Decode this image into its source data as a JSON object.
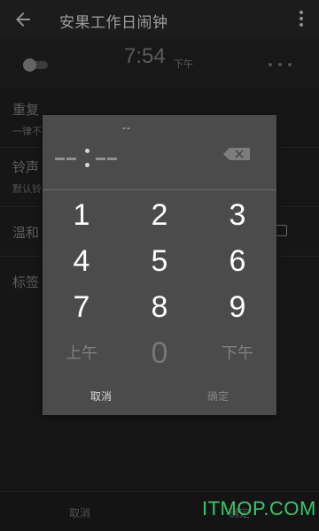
{
  "app_bar": {
    "title": "安果工作日闹钟",
    "back_icon": "arrow-left-icon",
    "menu_icon": "more-vertical-icon"
  },
  "alarm": {
    "time": "7:54",
    "ampm": "下午",
    "enabled": false,
    "more_icon": "more-horizontal-icon"
  },
  "settings": {
    "repeat": {
      "label": "重复",
      "value": "一律不"
    },
    "ringtone": {
      "label": "铃声",
      "value": "默认铃"
    },
    "gentle": {
      "label": "温和",
      "checked": false
    },
    "tag": {
      "label": "标签"
    }
  },
  "bottom_bar": {
    "cancel": "取消",
    "ok": "确定"
  },
  "picker": {
    "top_text": "--",
    "backspace_icon": "backspace-icon",
    "keys": [
      {
        "label": "1",
        "enabled": true
      },
      {
        "label": "2",
        "enabled": true
      },
      {
        "label": "3",
        "enabled": true
      },
      {
        "label": "4",
        "enabled": true
      },
      {
        "label": "5",
        "enabled": true
      },
      {
        "label": "6",
        "enabled": true
      },
      {
        "label": "7",
        "enabled": true
      },
      {
        "label": "8",
        "enabled": true
      },
      {
        "label": "9",
        "enabled": true
      },
      {
        "label": "上午",
        "enabled": false
      },
      {
        "label": "0",
        "enabled": false
      },
      {
        "label": "下午",
        "enabled": false
      }
    ],
    "cancel": "取消",
    "ok": "确定"
  },
  "watermark": "ITMOP.COM",
  "colors": {
    "background": "#222222",
    "dialog": "#4b4b4b",
    "key_active": "#ffffff",
    "key_disabled": "#767676",
    "watermark": "#3ac76b"
  }
}
